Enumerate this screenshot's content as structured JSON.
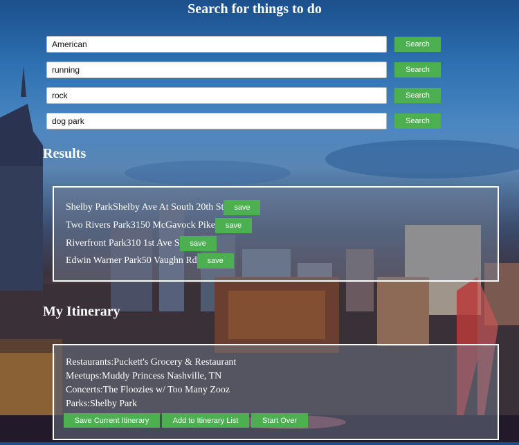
{
  "page": {
    "title": "Search for things to do"
  },
  "search": {
    "button_label": "Search",
    "fields": [
      {
        "value": "American"
      },
      {
        "value": "running"
      },
      {
        "value": "rock"
      },
      {
        "value": "dog park"
      }
    ]
  },
  "results": {
    "heading": "Results",
    "save_label": "save",
    "items": [
      {
        "text": "Shelby ParkShelby Ave At South 20th St"
      },
      {
        "text": "Two Rivers Park3150 McGavock Pike"
      },
      {
        "text": "Riverfront Park310 1st Ave S"
      },
      {
        "text": "Edwin Warner Park50 Vaughn Rd"
      }
    ]
  },
  "itinerary": {
    "heading": "My Itinerary",
    "lines": [
      {
        "text": "Restaurants:Puckett's Grocery & Restaurant"
      },
      {
        "text": "Meetups:Muddy Princess Nashville, TN"
      },
      {
        "text": "Concerts:The Floozies w/ Too Many Zooz"
      },
      {
        "text": "Parks:Shelby Park"
      }
    ],
    "buttons": {
      "save_current": "Save Current Itinerary",
      "add_to_list": "Add to Itinerary List",
      "start_over": "Start Over"
    }
  },
  "colors": {
    "accent": "#4caf50",
    "panel_border": "#ffffff"
  }
}
